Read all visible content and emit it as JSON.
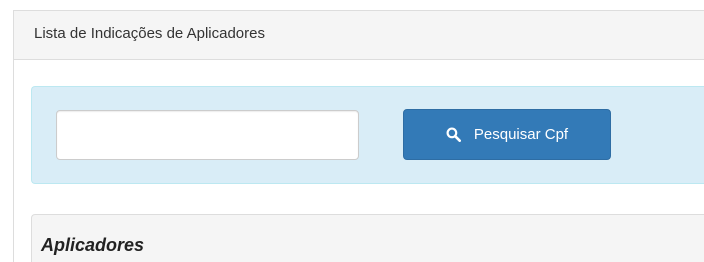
{
  "panel": {
    "title": "Lista de Indicações de Aplicadores"
  },
  "search": {
    "input_value": "",
    "input_placeholder": "",
    "button_icon": "search-icon",
    "button_label": "Pesquisar Cpf"
  },
  "section": {
    "title": "Aplicadores"
  },
  "colors": {
    "primary_button": "#337ab7",
    "info_well": "#d9edf7",
    "panel_heading": "#f5f5f5"
  }
}
